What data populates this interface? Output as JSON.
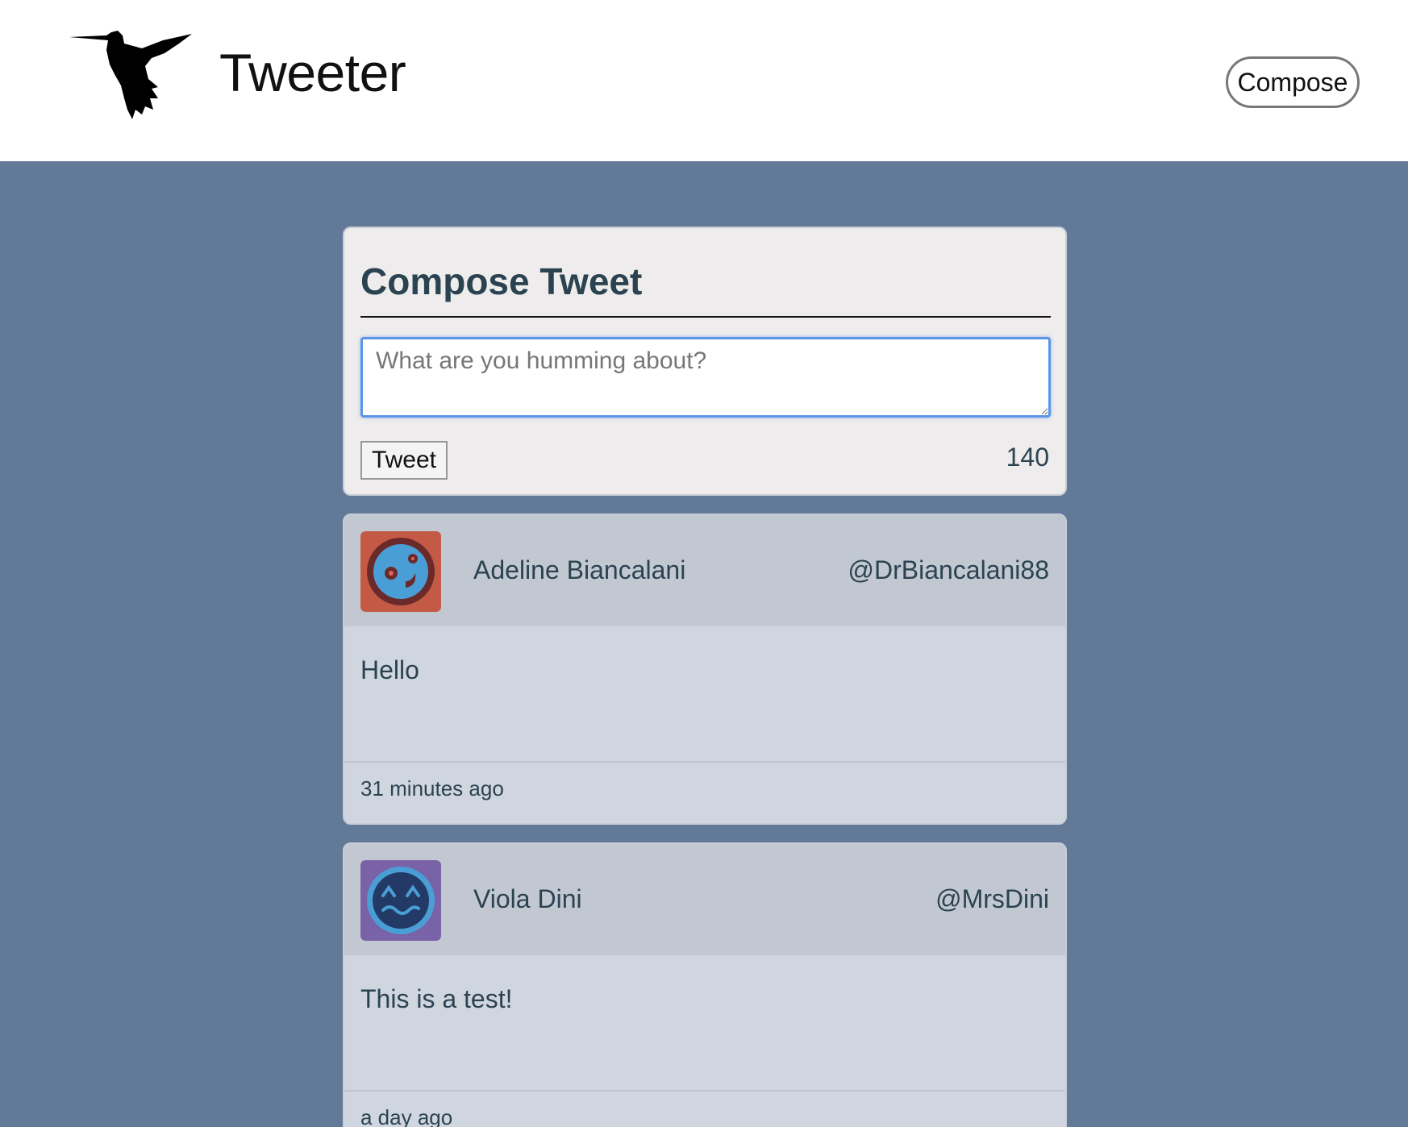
{
  "header": {
    "app_title": "Tweeter",
    "compose_label": "Compose",
    "logo_icon": "hummingbird-icon"
  },
  "compose": {
    "title": "Compose Tweet",
    "placeholder": "What are you humming about?",
    "value": "",
    "submit_label": "Tweet",
    "char_count": "140"
  },
  "tweets": [
    {
      "name": "Adeline Biancalani",
      "handle": "@DrBiancalani88",
      "text": "Hello",
      "time": "31 minutes ago",
      "avatar": {
        "icon": "smiley-face-avatar",
        "bg": "#c45a45",
        "face": "#4a9ed6"
      }
    },
    {
      "name": "Viola Dini",
      "handle": "@MrsDini",
      "text": "This is a test!",
      "time": "a day ago",
      "avatar": {
        "icon": "grimace-face-avatar",
        "bg": "#7a62a8",
        "face": "#233a66"
      }
    }
  ],
  "colors": {
    "page_bg": "#627a98",
    "card_bg": "#d0d6e0",
    "text": "#2b4350",
    "focus": "#5b95e6"
  }
}
